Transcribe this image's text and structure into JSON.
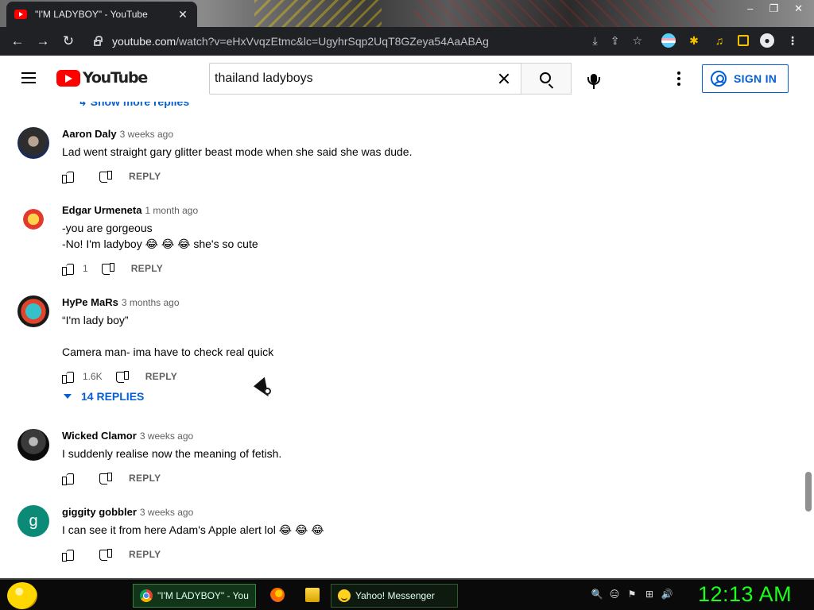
{
  "browser": {
    "tab_title": "\"I'M LADYBOY\" - YouTube",
    "tab_close": "✕",
    "window_controls": [
      "–",
      "❐",
      "✕"
    ],
    "url_host": "youtube.com",
    "url_path": "/watch?v=eHxVvqzEtmc&lc=UgyhrSqp2UqT8GZeya54AaABAg",
    "nav": {
      "back": "←",
      "forward": "→",
      "reload": "↻"
    },
    "omni_icons": [
      "⤓",
      "⇪",
      "☆"
    ]
  },
  "youtube": {
    "logo_text": "YouTube",
    "search_value": "thailand ladyboys",
    "sign_in_label": "SIGN IN"
  },
  "comments": {
    "show_more_label": "↳ Show more replies",
    "items": [
      {
        "author": "Aaron Daly",
        "time": "3 weeks ago",
        "lines": [
          "Lad went straight gary glitter beast mode when she said she was dude."
        ],
        "likes": "",
        "reply_label": "REPLY"
      },
      {
        "author": "Edgar Urmeneta",
        "time": "1 month ago",
        "lines": [
          "-you are gorgeous",
          "-No! I'm ladyboy 😂 😂 😂  she's so cute"
        ],
        "likes": "1",
        "reply_label": "REPLY"
      },
      {
        "author": "HyPe MaRs",
        "time": "3 months ago",
        "lines": [
          "“I'm lady boy”",
          "",
          "Camera man- ima have to check real quick"
        ],
        "likes": "1.6K",
        "reply_label": "REPLY",
        "replies_label": "14 REPLIES"
      },
      {
        "author": "Wicked Clamor",
        "time": "3 weeks ago",
        "lines": [
          "I suddenly realise now the meaning of fetish."
        ],
        "likes": "",
        "reply_label": "REPLY"
      },
      {
        "author": "giggity gobbler",
        "time": "3 weeks ago",
        "lines": [
          "I can see it from here Adam's Apple alert lol 😂 😂 😂"
        ],
        "likes": "",
        "reply_label": "REPLY",
        "avatar_letter": "g"
      }
    ]
  },
  "taskbar": {
    "active_task": "\"I'M LADYBOY\" - You...",
    "ymsg_task": "Yahoo! Messenger",
    "clock": "12:13 AM",
    "tray_icons": [
      "🔍",
      "😑",
      "⚑",
      "⊞",
      "🔊"
    ]
  },
  "colors": {
    "accent_blue": "#065fd4",
    "youtube_red": "#ff0000",
    "clock_green": "#19ff19"
  }
}
